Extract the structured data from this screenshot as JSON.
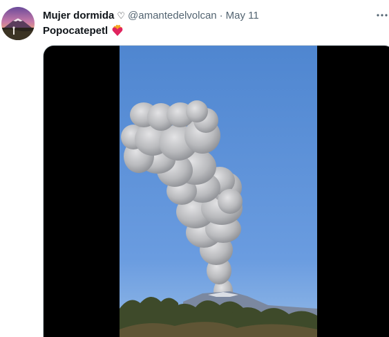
{
  "tweet": {
    "author": {
      "display_name": "Mujer dormida",
      "name_badge": "♡",
      "handle": "@amantedelvolcan",
      "avatar": "volcano-sunset-avatar"
    },
    "separator": "·",
    "date": "May 11",
    "text": "Popocatepetl",
    "text_emoji": "heart-on-fire-emoji",
    "more_icon": "more-dots-icon",
    "media": {
      "type": "video",
      "subject": "volcano-ash-plume"
    }
  },
  "colors": {
    "text_primary": "#0f1419",
    "text_secondary": "#536471",
    "sky": "#5b8fd6",
    "letterbox": "#000000"
  }
}
